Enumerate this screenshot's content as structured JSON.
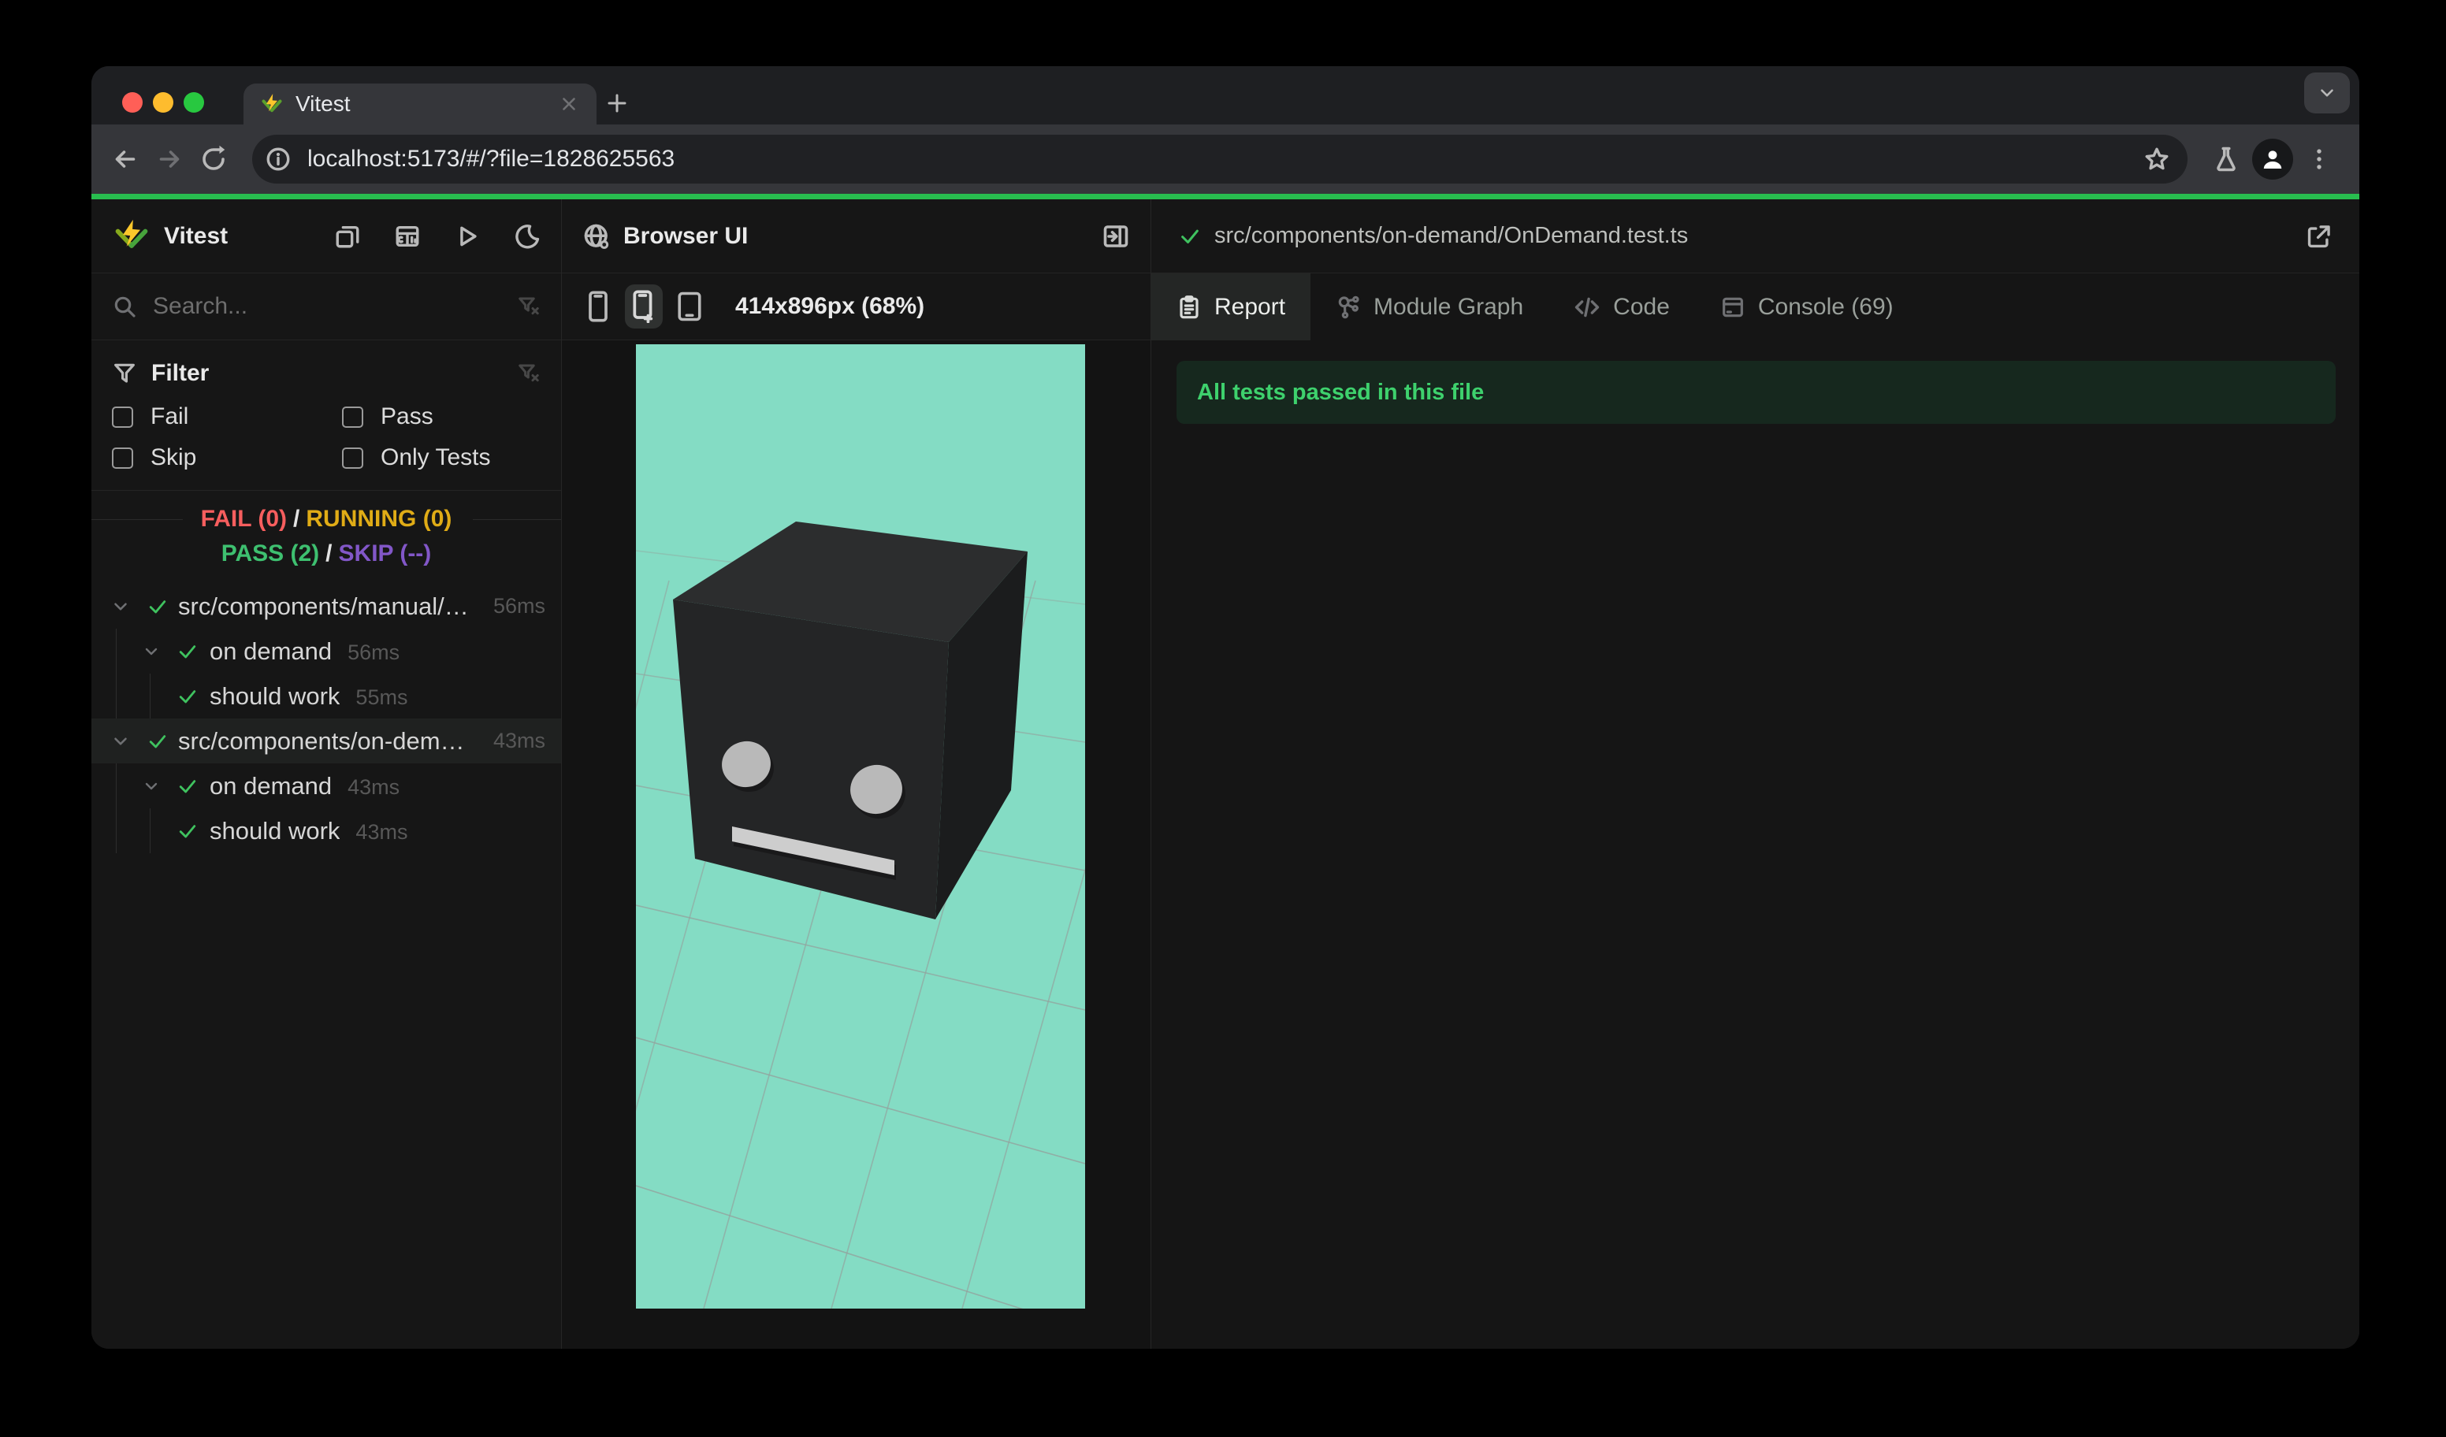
{
  "chrome": {
    "tab_title": "Vitest",
    "url": "localhost:5173/#/?file=1828625563"
  },
  "sidebar": {
    "app_title": "Vitest",
    "search_placeholder": "Search...",
    "filter_title": "Filter",
    "filters": [
      {
        "label": "Fail"
      },
      {
        "label": "Pass"
      },
      {
        "label": "Skip"
      },
      {
        "label": "Only Tests"
      }
    ],
    "stats": {
      "fail": "FAIL (0)",
      "sep1": "/",
      "running": "RUNNING (0)",
      "pass": "PASS (2)",
      "sep2": "/",
      "skip": "SKIP (--)"
    },
    "tree": [
      {
        "label": "src/components/manual/…",
        "time": "56ms"
      },
      {
        "label": "on demand",
        "time": "56ms"
      },
      {
        "label": "should work",
        "time": "55ms"
      },
      {
        "label": "src/components/on-dema…",
        "time": "43ms"
      },
      {
        "label": "on demand",
        "time": "43ms"
      },
      {
        "label": "should work",
        "time": "43ms"
      }
    ]
  },
  "browser_panel": {
    "title": "Browser UI",
    "viewport_label": "414x896px (68%)"
  },
  "report_panel": {
    "file_path": "src/components/on-demand/OnDemand.test.ts",
    "tabs": [
      {
        "label": "Report"
      },
      {
        "label": "Module Graph"
      },
      {
        "label": "Code"
      },
      {
        "label": "Console (69)"
      }
    ],
    "banner": "All tests passed in this file"
  },
  "colors": {
    "accent_green": "#28bd4f",
    "fail_red": "#f65e5e",
    "running_yellow": "#e0ac16",
    "pass_green": "#3ec070",
    "skip_purple": "#8257c8",
    "preview_bg": "#84dcc4"
  }
}
